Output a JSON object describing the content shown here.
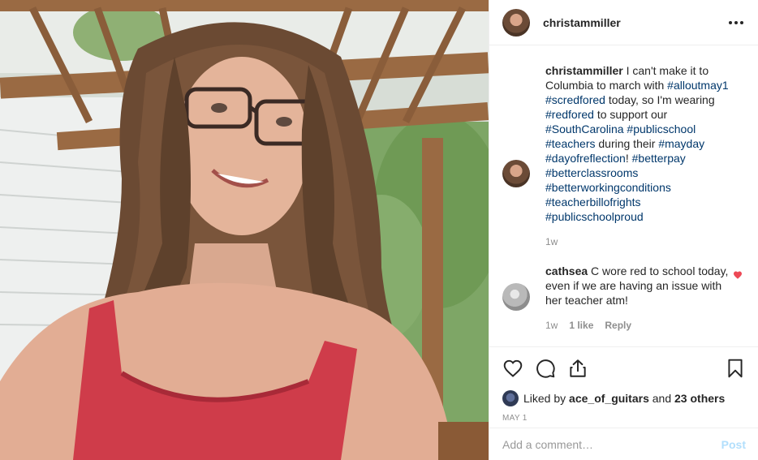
{
  "post": {
    "username": "christammiller",
    "caption_parts": [
      {
        "t": "text",
        "v": "I can't make it to Columbia to march with "
      },
      {
        "t": "tag",
        "v": "#alloutmay1"
      },
      {
        "t": "text",
        "v": " "
      },
      {
        "t": "tag",
        "v": "#scredfored"
      },
      {
        "t": "text",
        "v": " today, so I'm wearing "
      },
      {
        "t": "tag",
        "v": "#redfored"
      },
      {
        "t": "text",
        "v": " to support our "
      },
      {
        "t": "tag",
        "v": "#SouthCarolina"
      },
      {
        "t": "text",
        "v": " "
      },
      {
        "t": "tag",
        "v": "#publicschool"
      },
      {
        "t": "text",
        "v": " "
      },
      {
        "t": "tag",
        "v": "#teachers"
      },
      {
        "t": "text",
        "v": " during their "
      },
      {
        "t": "tag",
        "v": "#mayday"
      },
      {
        "t": "text",
        "v": " "
      },
      {
        "t": "tag",
        "v": "#dayofreflection"
      },
      {
        "t": "text",
        "v": "! "
      },
      {
        "t": "tag",
        "v": "#betterpay"
      },
      {
        "t": "text",
        "v": " "
      },
      {
        "t": "tag",
        "v": "#betterclassrooms"
      },
      {
        "t": "text",
        "v": " "
      },
      {
        "t": "tag",
        "v": "#betterworkingconditions"
      },
      {
        "t": "text",
        "v": " "
      },
      {
        "t": "tag",
        "v": "#teacherbillofrights"
      },
      {
        "t": "text",
        "v": " "
      },
      {
        "t": "tag",
        "v": "#publicschoolproud"
      }
    ],
    "caption_age": "1w",
    "comment": {
      "username": "cathsea",
      "text": "C wore red to school today, even if we are having an issue with her teacher atm!",
      "age": "1w",
      "likes": "1 like",
      "reply": "Reply"
    },
    "likes_prefix": "Liked by",
    "likes_user": "ace_of_guitars",
    "likes_and": "and",
    "likes_others": "23 others",
    "date": "MAY 1",
    "add_comment_placeholder": "Add a comment…",
    "post_button": "Post"
  },
  "colors": {
    "hashtag": "#00376b",
    "heart": "#ed4956",
    "post_button_disabled": "#b2dffc"
  }
}
